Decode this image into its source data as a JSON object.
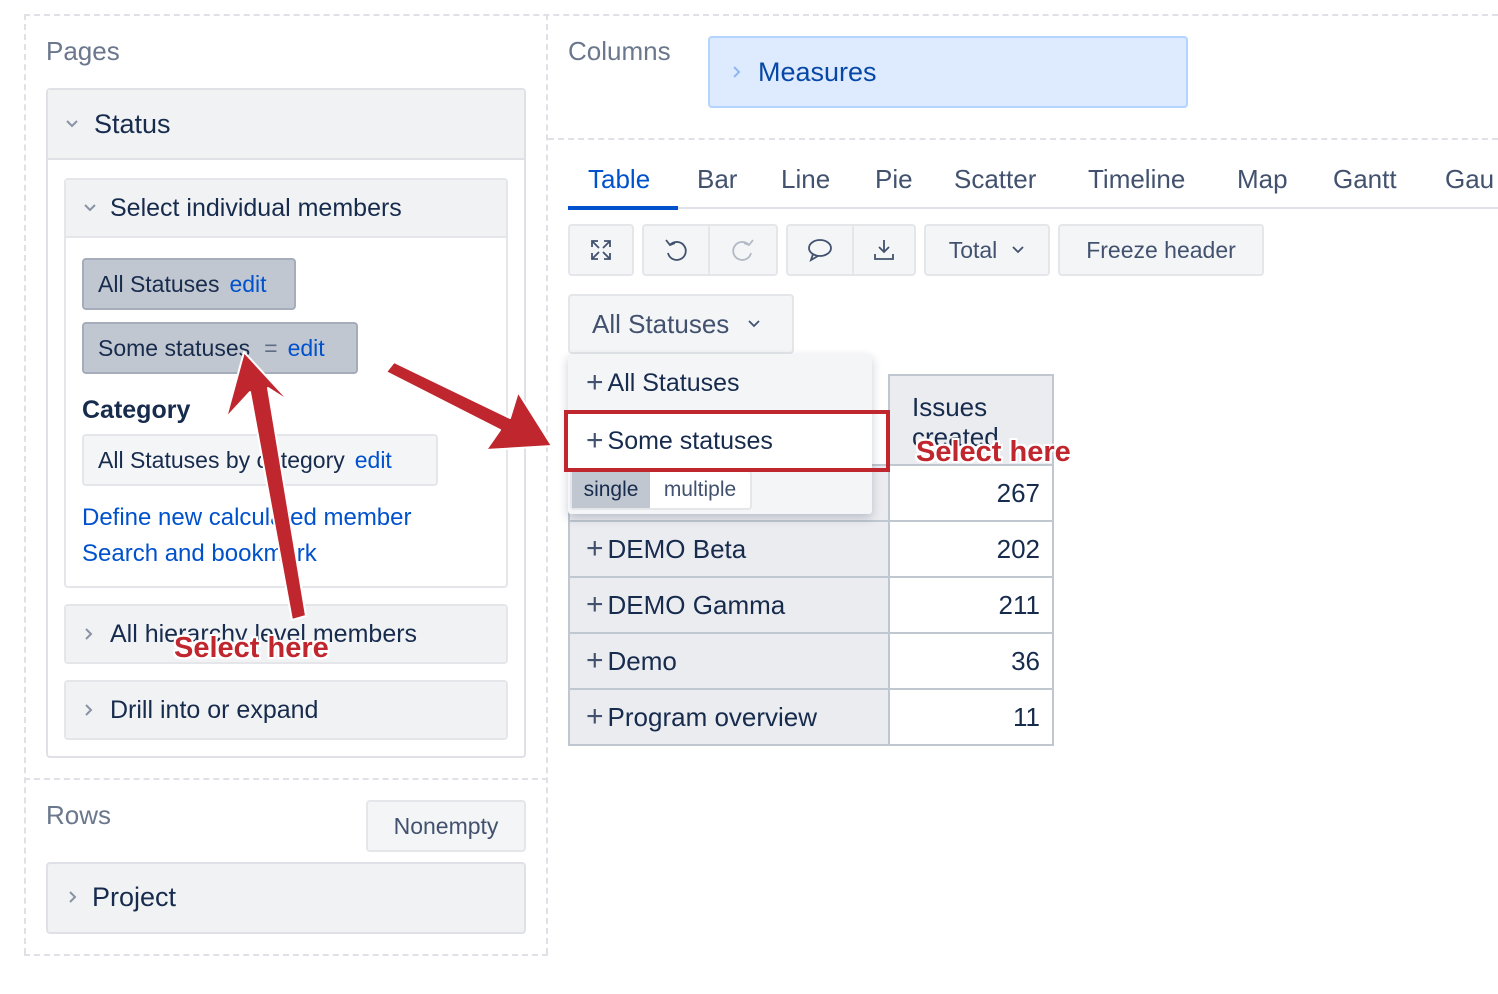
{
  "pages": {
    "title": "Pages",
    "dimension": "Status",
    "select_members": {
      "title": "Select individual members",
      "members": [
        {
          "label": "All Statuses",
          "edit": "edit"
        },
        {
          "label": "Some statuses",
          "eq": "=",
          "edit": "edit"
        }
      ],
      "category_title": "Category",
      "category_member": {
        "label": "All Statuses by category",
        "edit": "edit"
      },
      "links": [
        "Define new calculated member",
        "Search and bookmark"
      ]
    },
    "collapsed_sections": [
      "All hierarchy level members",
      "Drill into or expand"
    ]
  },
  "rows": {
    "title": "Rows",
    "nonempty_button": "Nonempty",
    "dimension": "Project"
  },
  "columns": {
    "title": "Columns",
    "measure": "Measures"
  },
  "tabs": [
    "Table",
    "Bar",
    "Line",
    "Pie",
    "Scatter",
    "Timeline",
    "Map",
    "Gantt",
    "Gau"
  ],
  "active_tab": "Table",
  "toolbar": {
    "total_label": "Total",
    "freeze_label": "Freeze header",
    "icons": [
      "fullscreen-icon",
      "undo-icon",
      "redo-icon",
      "comment-icon",
      "download-icon"
    ]
  },
  "page_filter": {
    "selected": "All Statuses",
    "options": [
      "All Statuses",
      "Some statuses"
    ],
    "mode_single": "single",
    "mode_multiple": "multiple"
  },
  "table": {
    "header": "Issues created",
    "rows": [
      {
        "label": "",
        "value": "267"
      },
      {
        "label": "DEMO Beta",
        "value": "202"
      },
      {
        "label": "DEMO Gamma",
        "value": "211"
      },
      {
        "label": "Demo",
        "value": "36"
      },
      {
        "label": "Program overview",
        "value": "11"
      }
    ]
  },
  "annotations": {
    "callout_left": "Select here",
    "callout_right": "Select here",
    "color": "#c0262d"
  }
}
